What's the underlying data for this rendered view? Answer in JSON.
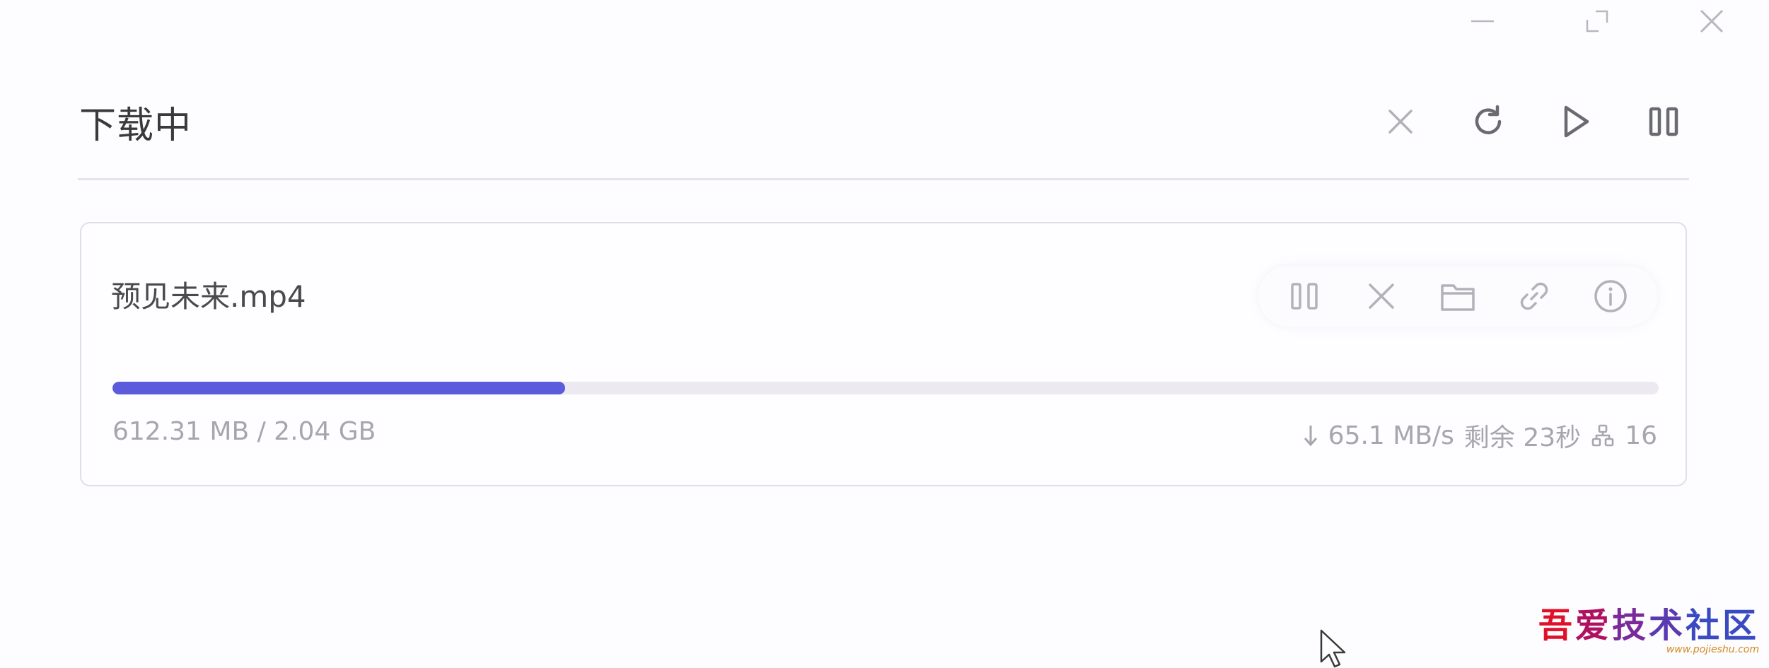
{
  "window": {
    "controls": [
      "minimize",
      "maximize",
      "close"
    ]
  },
  "header": {
    "title": "下载中",
    "actions": [
      "clear-icon",
      "refresh-icon",
      "play-icon",
      "pause-icon"
    ]
  },
  "task": {
    "file_name": "预见未来.mp4",
    "actions": [
      "pause-icon",
      "cancel-icon",
      "folder-icon",
      "link-icon",
      "info-icon"
    ],
    "progress_fraction": 0.2929,
    "size_text": "612.31 MB / 2.04 GB",
    "speed": "65.1 MB/s",
    "remaining": "剩余 23秒",
    "connections": "16"
  },
  "colors": {
    "accent": "#5b5bdc",
    "track": "#eceaf0",
    "icon": "#6a6a72",
    "icon_muted": "#b3b2b9"
  },
  "watermark": {
    "chars": [
      "吾",
      "爱",
      "技",
      "术",
      "社",
      "区"
    ],
    "url": "www.pojieshu.com"
  }
}
